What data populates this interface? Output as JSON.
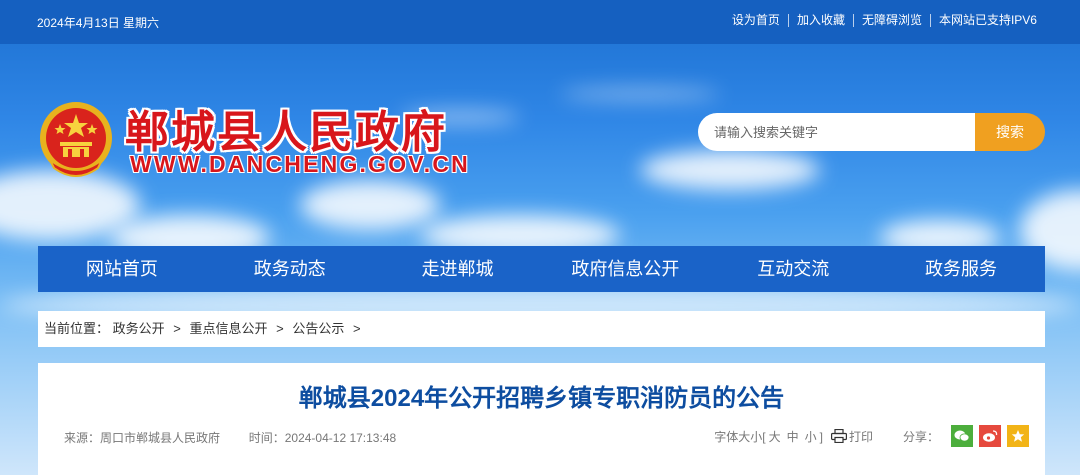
{
  "topbar": {
    "date": "2024年4月13日 星期六",
    "links": [
      "设为首页",
      "加入收藏",
      "无障碍浏览",
      "本网站已支持IPV6"
    ]
  },
  "header": {
    "site_name": "郸城县人民政府",
    "domain": "WWW.DANCHENG.GOV.CN",
    "search_placeholder": "请输入搜索关键字",
    "search_button": "搜索"
  },
  "nav": [
    "网站首页",
    "政务动态",
    "走进郸城",
    "政府信息公开",
    "互动交流",
    "政务服务"
  ],
  "breadcrumb": {
    "label": "当前位置：",
    "items": [
      "政务公开",
      "重点信息公开",
      "公告公示"
    ],
    "separator": ">"
  },
  "article": {
    "title": "郸城县2024年公开招聘乡镇专职消防员的公告",
    "source_label": "来源：",
    "source": "周口市郸城县人民政府",
    "time_label": "时间：",
    "time": "2024-04-12 17:13:48",
    "font_size_label": "字体大小[",
    "font_sizes": [
      "大",
      "中",
      "小"
    ],
    "font_size_close": "]",
    "print_label": "打印",
    "share_label": "分享："
  },
  "colors": {
    "brand_red": "#d8161b",
    "nav_blue": "#1a63c8",
    "title_blue": "#0d4da0",
    "search_orange": "#f0a020"
  },
  "icons": [
    "national-emblem-icon",
    "print-icon",
    "wechat-icon",
    "weibo-icon",
    "favorite-star-icon"
  ]
}
